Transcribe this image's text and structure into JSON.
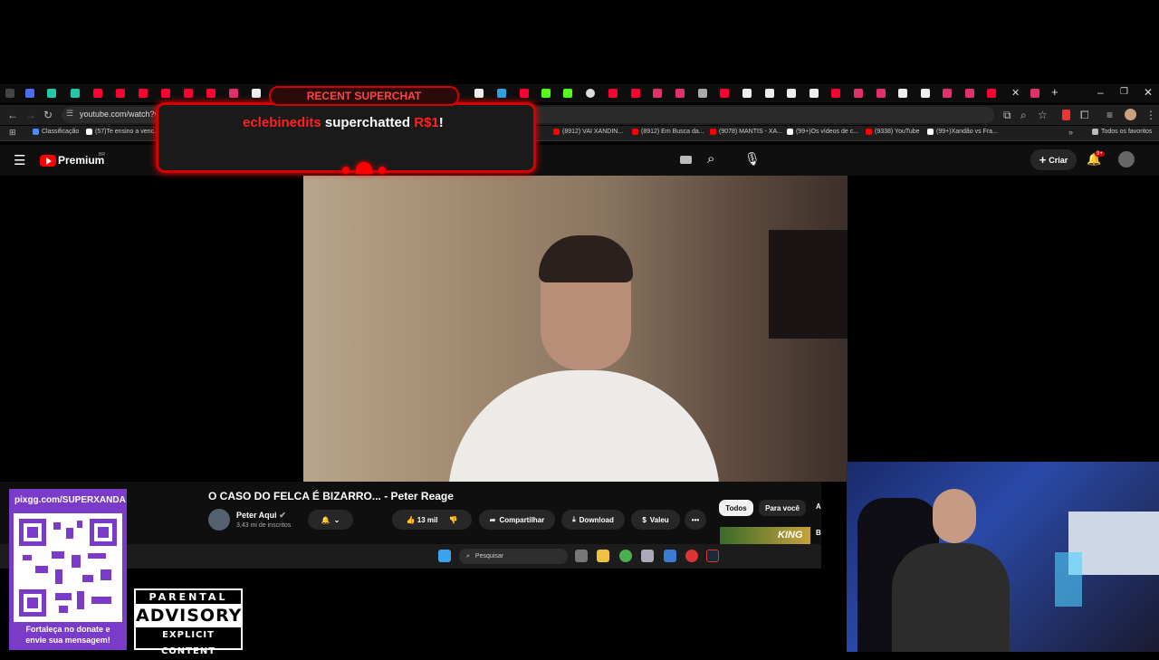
{
  "browser": {
    "url": "youtube.com/watch?v=m",
    "bookmarks": [
      {
        "label": "Classificação",
        "color": "#4c8bf5"
      },
      {
        "label": "(57)Te ensino a venc...",
        "color": "#ffffff"
      },
      {
        "label": "(8912) VAI XANDIN...",
        "color": "#ff0000"
      },
      {
        "label": "(8912) Em Busca da...",
        "color": "#ff0000"
      },
      {
        "label": "(9078) MANTIS - XA...",
        "color": "#ff0000"
      },
      {
        "label": "(99+)Os vídeos de c...",
        "color": "#ffffff"
      },
      {
        "label": "(9338) YouTube",
        "color": "#ff0000"
      },
      {
        "label": "(99+)Xandão vs Fra...",
        "color": "#ffffff"
      },
      {
        "label": "Todos os favoritos",
        "color": "#bbbbbb"
      }
    ]
  },
  "youtube": {
    "logo_text": "Premium",
    "region": "BR",
    "create_label": "Criar",
    "notif_count": "9+",
    "video_title": "O CASO DO FELCA É BIZARRO... - Peter Reage",
    "channel_name": "Peter Aqui",
    "subscribers": "3,43 mi de inscritos",
    "like_count": "13 mil",
    "share_label": "Compartilhar",
    "download_label": "Download",
    "thanks_label": "Valeu",
    "more_label": "•••",
    "chips": [
      "Todos",
      "Para você",
      "A"
    ],
    "rec_letter": "B",
    "rec_thumb_text": "KING"
  },
  "taskbar": {
    "search_placeholder": "Pesquisar"
  },
  "superchat": {
    "header": "RECENT SUPERCHAT",
    "name": "eclebinedits",
    "action": " superchatted ",
    "amount": "R$1",
    "suffix": "!"
  },
  "overlay": {
    "qr_url": "pixgg.com/SUPERXANDA",
    "qr_caption_1": "Fortaleça no donate e",
    "qr_caption_2": "envie sua mensagem!",
    "pa_top": "PARENTAL",
    "pa_mid": "ADVISORY",
    "pa_bot": "EXPLICIT CONTENT"
  },
  "colors": {
    "accent": "#ff0000",
    "superchat_red": "#d40000",
    "qr_purple": "#7a3cc8"
  }
}
